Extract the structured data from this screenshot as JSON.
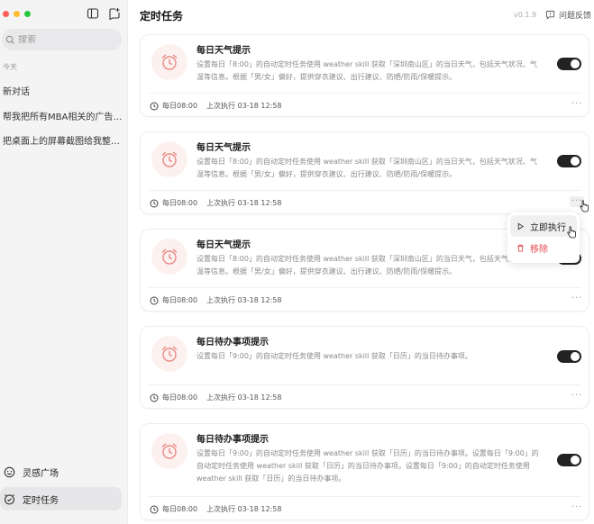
{
  "sidebar": {
    "search_placeholder": "搜索",
    "section_today": "今天",
    "history": [
      "新对话",
      "帮我把所有MBA相关的广告邮件都删除掉",
      "把桌面上的屏幕截图给我整理一下"
    ],
    "bottom": [
      {
        "label": "灵感广场",
        "icon": "smile-icon"
      },
      {
        "label": "定时任务",
        "icon": "clock-check-icon",
        "active": true
      }
    ]
  },
  "header": {
    "title": "定时任务",
    "version": "v0.1.9",
    "feedback_label": "问题反馈"
  },
  "colors": {
    "toggle_on": "#222222",
    "alarm_bg": "#fdf1f0",
    "alarm_stroke": "#e98a84",
    "danger": "#e5484d"
  },
  "tasks": [
    {
      "title": "每日天气提示",
      "desc": "设置每日「8:00」的自动定时任务使用 weather skill 获取「深圳南山区」的当日天气，包括天气状况、气温等信息。根据「男/女」偏好，提供穿衣建议、出行建议、防晒/防雨/保暖提示。",
      "schedule": "每日08:00",
      "last_run": "上次执行 03-18 12:58",
      "enabled": true
    },
    {
      "title": "每日天气提示",
      "desc": "设置每日「8:00」的自动定时任务使用 weather skill 获取「深圳南山区」的当日天气，包括天气状况、气温等信息。根据「男/女」偏好，提供穿衣建议、出行建议、防晒/防雨/保暖提示。",
      "schedule": "每日08:00",
      "last_run": "上次执行 03-18 12:58",
      "enabled": true
    },
    {
      "title": "每日天气提示",
      "desc": "设置每日「8:00」的自动定时任务使用 weather skill 获取「深圳南山区」的当日天气，包括天气状况、气温等信息。根据「男/女」偏好，提供穿衣建议、出行建议、防晒/防雨/保暖提示。",
      "schedule": "每日08:00",
      "last_run": "上次执行 03-18 12:58",
      "enabled": true
    },
    {
      "title": "每日待办事项提示",
      "desc": "设置每日「9:00」的自动定时任务使用 weather skill 获取「日历」的当日待办事项。",
      "schedule": "每日08:00",
      "last_run": "上次执行 03-18 12:58",
      "enabled": true
    },
    {
      "title": "每日待办事项提示",
      "desc": "设置每日「9:00」的自动定时任务使用 weather skill 获取「日历」的当日待办事项。设置每日「9:00」的自动定时任务使用 weather skill 获取「日历」的当日待办事项。设置每日「9:00」的自动定时任务使用 weather skill 获取「日历」的当日待办事项。",
      "schedule": "每日08:00",
      "last_run": "上次执行 03-18 12:58",
      "enabled": true
    }
  ],
  "more_label": "···",
  "context_menu": {
    "run_now": "立即执行",
    "remove": "移除"
  }
}
